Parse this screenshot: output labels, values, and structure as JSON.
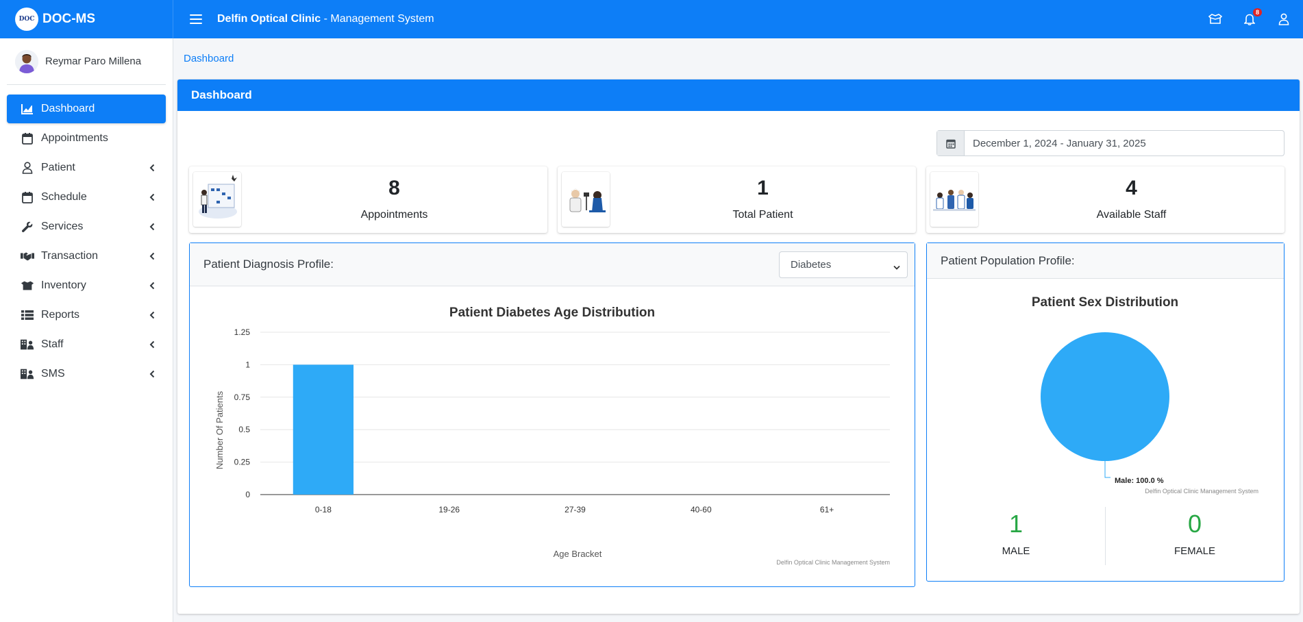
{
  "brand": {
    "short": "DOC-MS",
    "logo_text": "DOC"
  },
  "header": {
    "clinic": "Delfin Optical Clinic",
    "system": " - Management System",
    "notification_count": "8"
  },
  "user": {
    "name": "Reymar Paro Millena"
  },
  "sidebar": {
    "items": [
      {
        "label": "Dashboard",
        "icon": "chart-area-icon",
        "active": true
      },
      {
        "label": "Appointments",
        "icon": "calendar-icon"
      },
      {
        "label": "Patient",
        "icon": "user-icon",
        "has_children": true
      },
      {
        "label": "Schedule",
        "icon": "calendar-icon",
        "has_children": true
      },
      {
        "label": "Services",
        "icon": "wrench-icon",
        "has_children": true
      },
      {
        "label": "Transaction",
        "icon": "handshake-icon",
        "has_children": true
      },
      {
        "label": "Inventory",
        "icon": "box-open-icon",
        "has_children": true
      },
      {
        "label": "Reports",
        "icon": "list-icon",
        "has_children": true
      },
      {
        "label": "Staff",
        "icon": "users-building-icon",
        "has_children": true
      },
      {
        "label": "SMS",
        "icon": "users-building-icon",
        "has_children": true
      }
    ]
  },
  "breadcrumb": "Dashboard",
  "dashboard": {
    "title": "Dashboard",
    "date_range": "December 1, 2024 - January 31, 2025",
    "stats": [
      {
        "value": "8",
        "label": "Appointments"
      },
      {
        "value": "1",
        "label": "Total Patient"
      },
      {
        "value": "4",
        "label": "Available Staff"
      }
    ]
  },
  "diagnosis_panel": {
    "title": "Patient Diagnosis Profile:",
    "selected": "Diabetes"
  },
  "population_panel": {
    "title": "Patient Population Profile:",
    "male_count": "1",
    "male_label": "MALE",
    "female_count": "0",
    "female_label": "FEMALE"
  },
  "chart_data": [
    {
      "type": "bar",
      "title": "Patient Diabetes Age Distribution",
      "categories": [
        "0-18",
        "19-26",
        "27-39",
        "40-60",
        "61+"
      ],
      "values": [
        1,
        0,
        0,
        0,
        0
      ],
      "xlabel": "Age Bracket",
      "ylabel": "Number Of Patients",
      "ylim": [
        0,
        1.25
      ],
      "yticks": [
        "0",
        "0.25",
        "0.5",
        "0.75",
        "1",
        "1.25"
      ],
      "credit": "Delfin Optical Clinic Management System",
      "color": "#2eaaf7"
    },
    {
      "type": "pie",
      "title": "Patient Sex Distribution",
      "slices": [
        {
          "name": "Male",
          "value": 100.0,
          "label": "Male: 100.0 %"
        }
      ],
      "credit": "Delfin Optical Clinic Management System",
      "color": "#2eaaf7"
    }
  ],
  "colors": {
    "primary": "#0d7ef7",
    "bar": "#2eaaf7",
    "count": "#28a745"
  }
}
